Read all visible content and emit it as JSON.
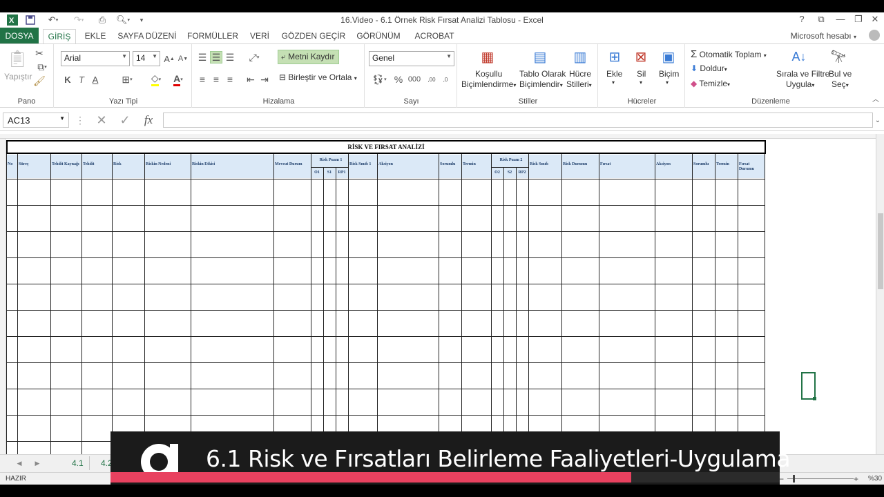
{
  "window": {
    "title": "16.Video - 6.1 Örnek Risk Fırsat Analizi Tablosu - Excel",
    "account": "Microsoft hesabı"
  },
  "tabs": [
    "DOSYA",
    "GİRİŞ",
    "EKLE",
    "SAYFA DÜZENİ",
    "FORMÜLLER",
    "VERİ",
    "GÖZDEN GEÇİR",
    "GÖRÜNÜM",
    "ACROBAT"
  ],
  "ribbon": {
    "clipboard": {
      "paste": "Yapıştır",
      "label": "Pano"
    },
    "font": {
      "name": "Arial",
      "size": "14",
      "label": "Yazı Tipi",
      "bold": "K",
      "italic": "T",
      "underline": "A"
    },
    "alignment": {
      "wrap": "Metni Kaydır",
      "merge": "Birleştir ve Ortala",
      "label": "Hizalama"
    },
    "number": {
      "format": "Genel",
      "label": "Sayı"
    },
    "styles": {
      "conditional_1": "Koşullu",
      "conditional_2": "Biçimlendirme",
      "table_1": "Tablo Olarak",
      "table_2": "Biçimlendir",
      "cell_1": "Hücre",
      "cell_2": "Stilleri",
      "label": "Stiller"
    },
    "cells": {
      "insert": "Ekle",
      "delete": "Sil",
      "format": "Biçim",
      "label": "Hücreler"
    },
    "editing": {
      "autosum": "Otomatik Toplam",
      "fill": "Doldur",
      "clear": "Temizle",
      "sort_1": "Sırala ve Filtre",
      "sort_2": "Uygula",
      "find_1": "Bul ve",
      "find_2": "Seç",
      "label": "Düzenleme"
    }
  },
  "formula_bar": {
    "name_box": "AC13",
    "fx": "fx",
    "value": ""
  },
  "sheet": {
    "title": "RİSK VE FIRSAT ANALİZİ",
    "headers": [
      "No",
      "Süreç",
      "Tehdit Kaynağı",
      "Tehdit",
      "Risk",
      "Riskin Nedeni",
      "Riskin Etkisi",
      "Mevcut Durum",
      "Risk Puanı 1",
      "O1",
      "S1",
      "RP1",
      "Risk Sınıfı 1",
      "Aksiyon",
      "Sorumlu",
      "Termin",
      "Risk Puanı 2",
      "O2",
      "S2",
      "RP2",
      "Risk Sınıfı",
      "Risk Durumu",
      "Fırsat",
      "Aksiyon",
      "Sorumlu",
      "Termin",
      "Fırsat Durumu"
    ]
  },
  "sheet_tabs": [
    "4.1",
    "4.2"
  ],
  "status": {
    "ready": "HAZIR",
    "zoom": "%30"
  },
  "banner": {
    "text": "6.1 Risk ve Fırsatları Belirleme Faaliyetleri-Uygulama",
    "progress": 0.778
  },
  "colors": {
    "excel_green": "#217346",
    "banner_bg": "#1b1b1b",
    "progress": "#e8415f",
    "header_fill": "#dbe9f7"
  }
}
